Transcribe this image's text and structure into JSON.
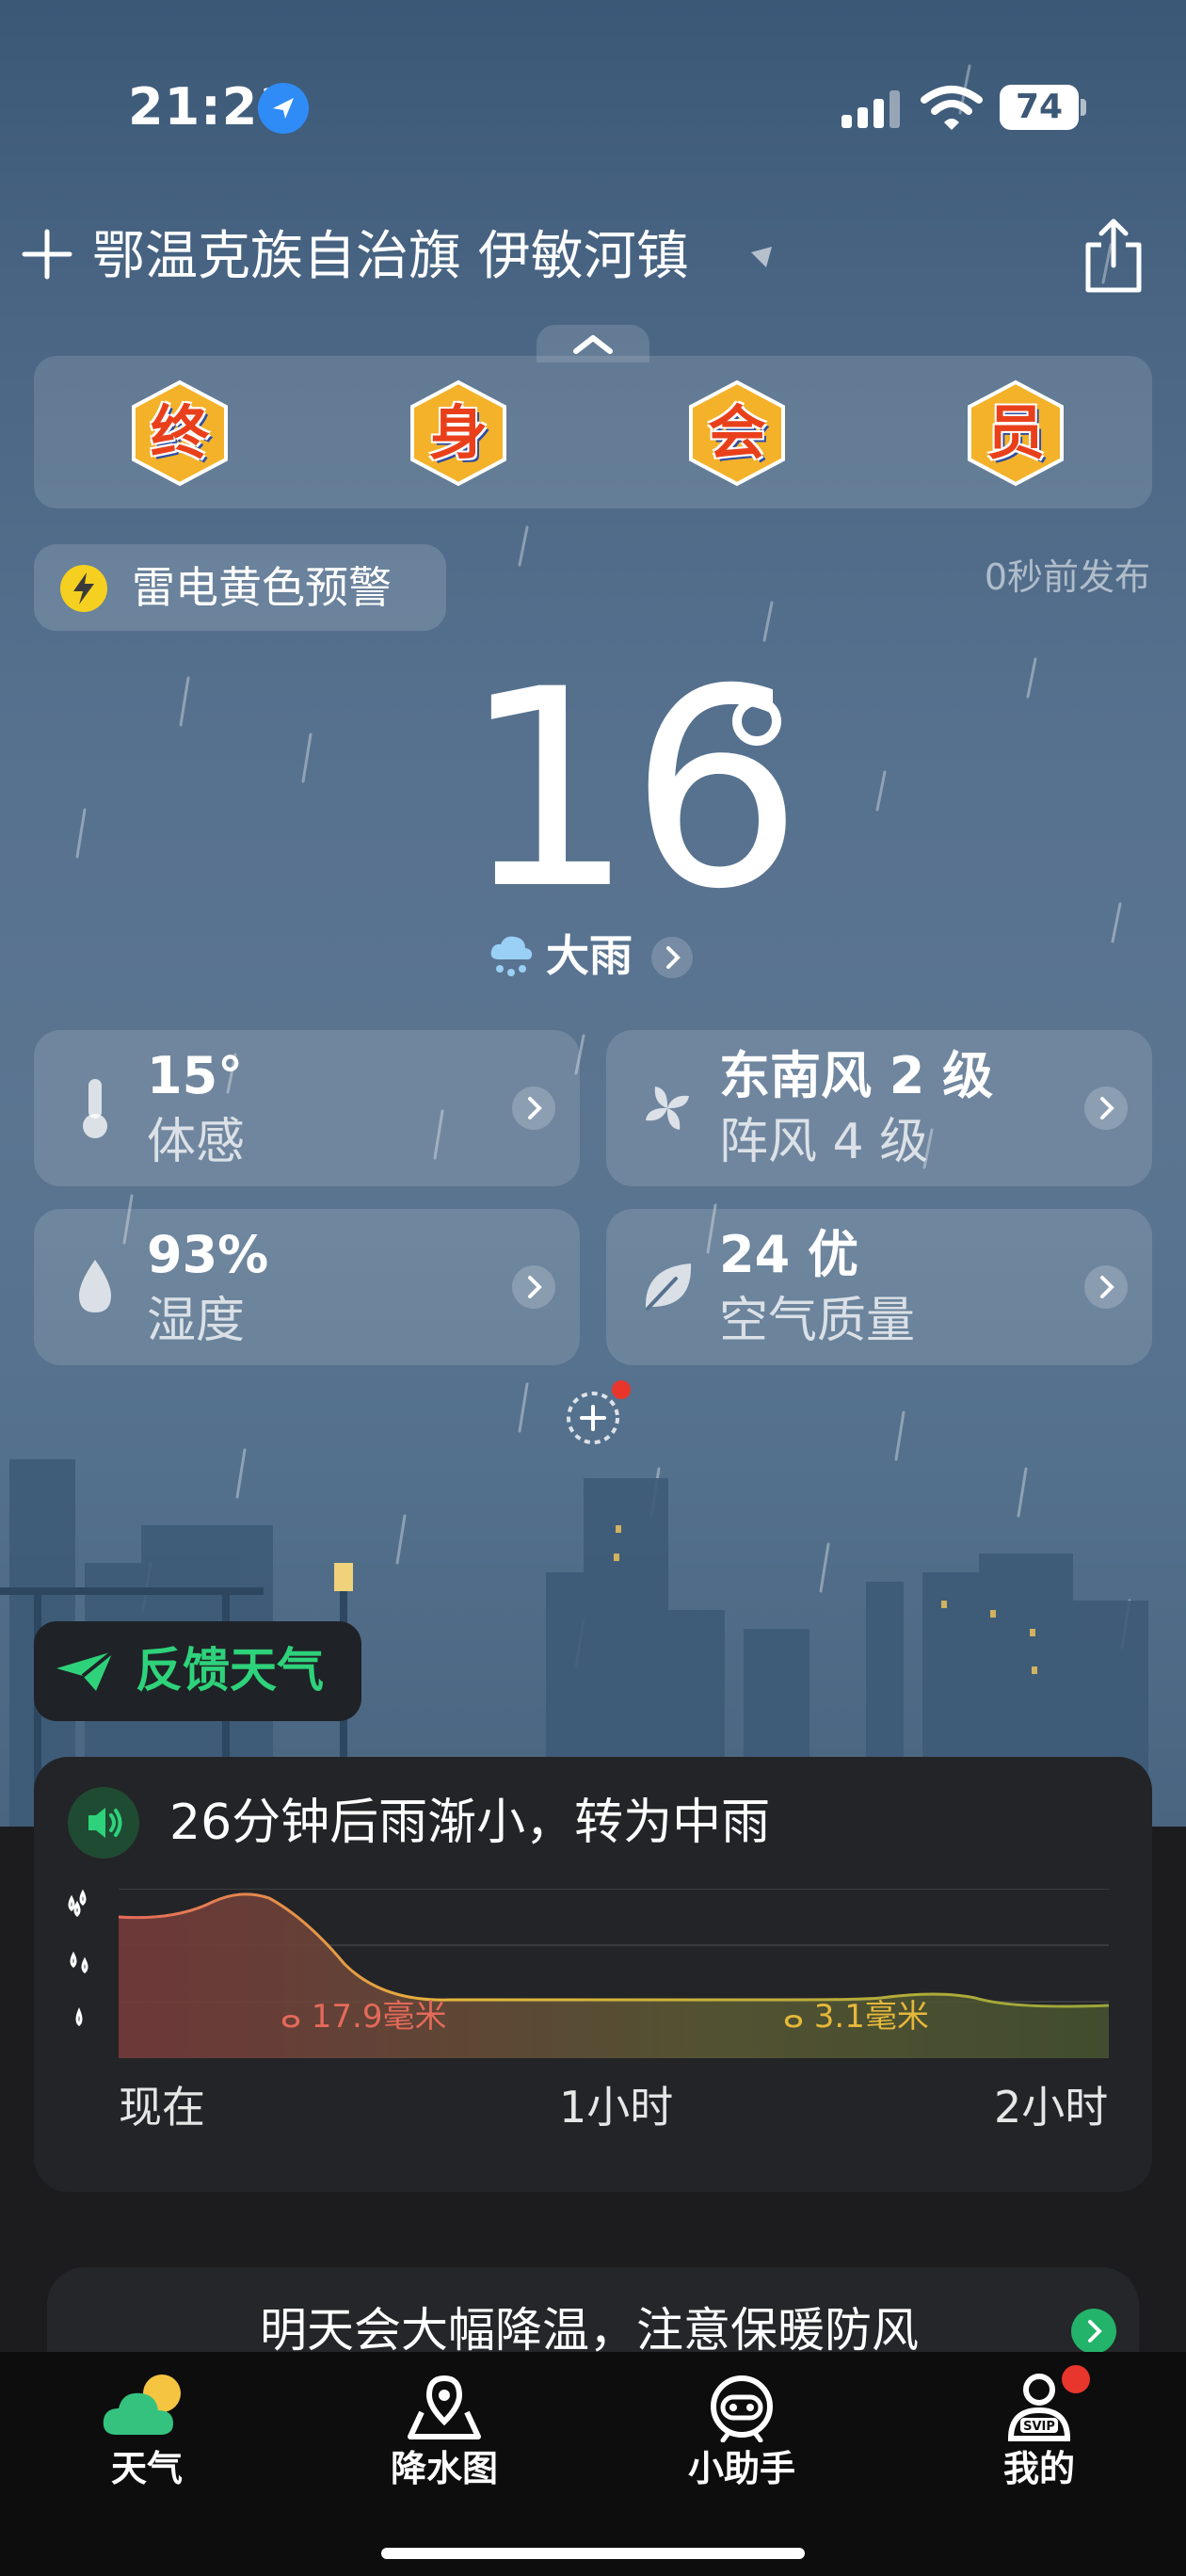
{
  "status_bar": {
    "time": "21:21",
    "battery": "74"
  },
  "header": {
    "location": "鄂温克族自治旗 伊敏河镇"
  },
  "badges": [
    "终",
    "身",
    "会",
    "员"
  ],
  "alert": {
    "text": "雷电黄色预警",
    "published": "0秒前发布"
  },
  "current": {
    "temperature": "16",
    "condition": "大雨"
  },
  "details": [
    {
      "value": "15°",
      "label": "体感",
      "icon": "thermometer-icon"
    },
    {
      "value": "东南风 2 级",
      "label": "阵风 4 级",
      "icon": "fan-icon"
    },
    {
      "value": "93%",
      "label": "湿度",
      "icon": "droplet-icon"
    },
    {
      "value": "24 优",
      "label": "空气质量",
      "icon": "leaf-icon"
    }
  ],
  "feedback": {
    "label": "反馈天气"
  },
  "forecast": {
    "title": "26分钟后雨渐小，转为中雨",
    "peak_label": "17.9毫米",
    "later_label": "3.1毫米",
    "x_labels": [
      "现在",
      "1小时",
      "2小时"
    ],
    "colors": {
      "heavy": "#e46a5a",
      "moderate": "#e6b83a"
    }
  },
  "tip": {
    "text": "明天会大幅降温，注意保暖防风"
  },
  "tabs": [
    {
      "label": "天气",
      "icon": "weather-icon"
    },
    {
      "label": "降水图",
      "icon": "map-pin-icon"
    },
    {
      "label": "小助手",
      "icon": "assistant-icon"
    },
    {
      "label": "我的",
      "icon": "profile-svip-icon",
      "badge_text": "SVIP"
    }
  ]
}
